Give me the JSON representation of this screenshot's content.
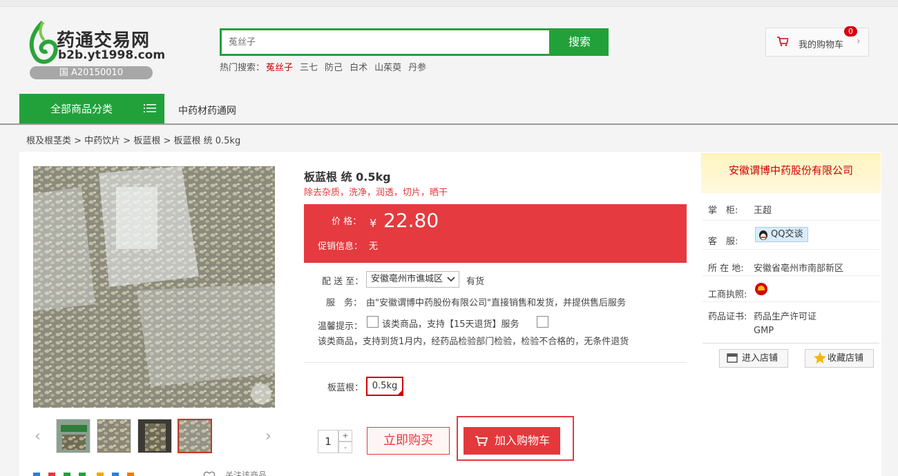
{
  "header": {
    "logo_name": "药通交易网",
    "logo_url": "b2b.yt1998.com",
    "logo_license": "国 A20150010",
    "search_placeholder": "菟丝子",
    "search_button": "搜索",
    "hot_label": "热门搜索：",
    "hot_items": [
      "菟丝子",
      "三七",
      "防己",
      "白术",
      "山茱萸",
      "丹参"
    ],
    "cart_label": "我的购物车",
    "cart_count": "0"
  },
  "nav": {
    "all_categories": "全部商品分类",
    "link": "中药材药通网"
  },
  "breadcrumb": "根及根茎类 > 中药饮片 > 板蓝根  >  板蓝根 统 0.5kg",
  "product": {
    "title": "板蓝根 统 0.5kg",
    "subtitle": "除去杂质，洗净，润透，切片，晒干",
    "price_label": "价  格：",
    "currency": "¥",
    "price": "22.80",
    "promo_label": "促销信息：",
    "promo_value": "无",
    "ship_label": "配 送 至：",
    "ship_region": "安徽亳州市谯城区",
    "stock": "有货",
    "service_label": "服　务：",
    "service_text": "由\"安徽谓博中药股份有限公司\"直接销售和发货，并提供售后服务",
    "notice_label": "温馨提示：",
    "notice_text1": "该类商品，支持【15天退货】服务",
    "notice_text2": "该类商品，支持到货1月内，经药品检验部门检验，检验不合格的，无条件退货",
    "spec_label": "板蓝根：",
    "spec_value": "0.5kg",
    "qty": "1",
    "buy_now": "立即购买",
    "add_cart": "加入购物车",
    "follow": "关注该商品"
  },
  "shop": {
    "name": "安徽谓博中药股份有限公司",
    "rows": [
      {
        "label": "掌　柜:",
        "value": "王超"
      },
      {
        "label": "客　服:",
        "value": "QQ交谈"
      },
      {
        "label": "所 在 地:",
        "value": "安徽省亳州市南部新区"
      },
      {
        "label": "工商执照:",
        "value": ""
      },
      {
        "label": "药品证书:",
        "value": "药品生产许可证"
      },
      {
        "label": "",
        "value": "GMP"
      }
    ],
    "enter_shop": "进入店铺",
    "fav_shop": "收藏店铺"
  },
  "colors": {
    "green": "#22a13a",
    "red": "#e53a3f",
    "shop_name": "#cc0000"
  }
}
